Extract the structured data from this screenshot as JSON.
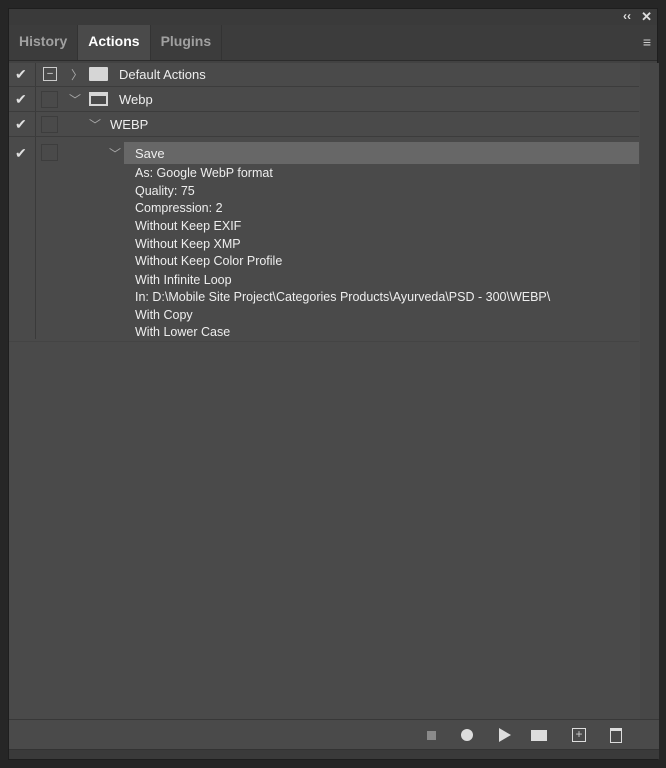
{
  "window": {
    "collapse_icon": "double-chevron-left-icon",
    "close_icon": "close-icon"
  },
  "tabs": [
    {
      "label": "History"
    },
    {
      "label": "Actions"
    },
    {
      "label": "Plugins"
    }
  ],
  "rows": [
    {
      "label": "Default Actions",
      "checked": true
    },
    {
      "label": "Webp",
      "checked": true
    },
    {
      "label": "WEBP",
      "checked": true
    },
    {
      "label": "Save",
      "checked": true
    }
  ],
  "details": [
    "As: Google WebP format",
    "Quality: 75",
    "Compression: 2",
    "Without Keep EXIF",
    "Without Keep XMP",
    "Without Keep Color Profile",
    "With Infinite Loop",
    "In: D:\\Mobile Site Project\\Categories Products\\Ayurveda\\PSD - 300\\WEBP\\",
    "With Copy",
    "With Lower Case"
  ],
  "toolbar": [
    "stop-icon",
    "record-icon",
    "play-icon",
    "new-set-icon",
    "new-action-icon",
    "trash-icon"
  ]
}
